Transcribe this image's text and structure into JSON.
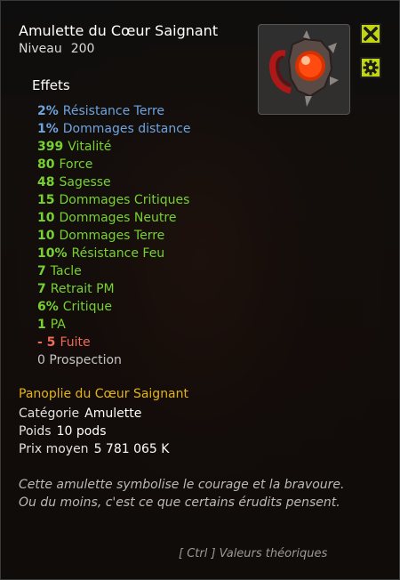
{
  "item": {
    "name": "Amulette du Cœur Saignant",
    "level_label": "Niveau",
    "level_value": "200"
  },
  "effects_title": "Effets",
  "effects": [
    {
      "value": "2%",
      "label": "Résistance Terre",
      "color": "blue"
    },
    {
      "value": "1%",
      "label": "Dommages distance",
      "color": "blue"
    },
    {
      "value": "399",
      "label": "Vitalité",
      "color": "green"
    },
    {
      "value": "80",
      "label": "Force",
      "color": "green"
    },
    {
      "value": "48",
      "label": "Sagesse",
      "color": "green"
    },
    {
      "value": "15",
      "label": "Dommages Critiques",
      "color": "green"
    },
    {
      "value": "10",
      "label": "Dommages Neutre",
      "color": "green"
    },
    {
      "value": "10",
      "label": "Dommages Terre",
      "color": "green"
    },
    {
      "value": "10%",
      "label": "Résistance Feu",
      "color": "green"
    },
    {
      "value": "7",
      "label": "Tacle",
      "color": "green"
    },
    {
      "value": "7",
      "label": "Retrait PM",
      "color": "green"
    },
    {
      "value": "6%",
      "label": "Critique",
      "color": "green"
    },
    {
      "value": "1",
      "label": "PA",
      "color": "green"
    },
    {
      "value": "- 5",
      "label": "Fuite",
      "color": "red"
    },
    {
      "value": "0",
      "label": "Prospection",
      "color": "grey"
    }
  ],
  "panoplie": "Panoplie du Cœur Saignant",
  "category": {
    "label": "Catégorie",
    "value": "Amulette"
  },
  "weight": {
    "label": "Poids",
    "value": "10 pods"
  },
  "price": {
    "label": "Prix moyen",
    "value": "5 781 065 K"
  },
  "description": "Cette amulette symbolise le courage et la bravoure. Ou du moins, c'est ce que certains érudits pensent.",
  "hint": "[ Ctrl ] Valeurs théoriques",
  "colors": {
    "accent_button": "#c2d610",
    "panoplie_gold": "#e4b414",
    "effect_blue": "#6ea3de",
    "effect_green": "#77d230",
    "effect_red": "#f06a55"
  },
  "icons": [
    "close-icon",
    "gear-icon",
    "amulet-icon"
  ]
}
